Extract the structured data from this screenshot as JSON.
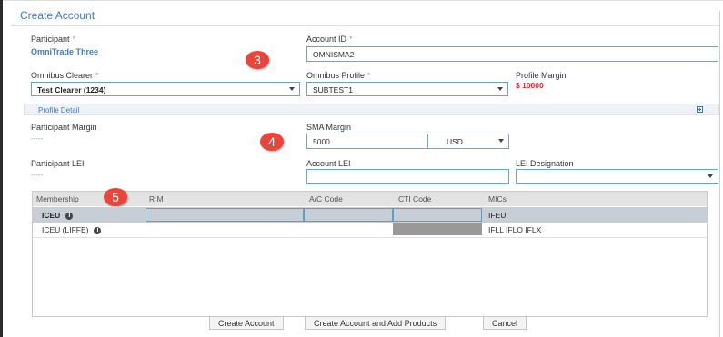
{
  "dialog": {
    "title": "Create Account"
  },
  "participant": {
    "label": "Participant",
    "req": "*",
    "value": "OmniTrade Three"
  },
  "account_id": {
    "label": "Account ID",
    "req": "*",
    "value": "OMNISMA2"
  },
  "omnibus_clearer": {
    "label": "Omnibus Clearer",
    "req": "*",
    "value": "Test Clearer (1234)"
  },
  "omnibus_profile": {
    "label": "Omnibus Profile",
    "req": "*",
    "value": "SUBTEST1"
  },
  "profile_margin": {
    "label": "Profile Margin",
    "value": "$ 10000"
  },
  "profile_detail": {
    "label": "Profile Detail"
  },
  "participant_margin": {
    "label": "Participant Margin",
    "value": "-----"
  },
  "sma_margin": {
    "label": "SMA Margin",
    "value": "5000",
    "currency": "USD"
  },
  "participant_lei": {
    "label": "Participant LEI",
    "value": "-----"
  },
  "account_lei": {
    "label": "Account LEI",
    "value": ""
  },
  "lei_designation": {
    "label": "LEI Designation",
    "value": ""
  },
  "badges": [
    "3",
    "4",
    "5"
  ],
  "table": {
    "headers": [
      "Membership",
      "RIM",
      "A/C Code",
      "CTI Code",
      "MICs"
    ],
    "rows": [
      {
        "membership": "ICEU",
        "mics": "IFEU"
      },
      {
        "membership": "ICEU (LIFFE)",
        "mics": "IFLL IFLO IFLX"
      }
    ]
  },
  "buttons": {
    "create": "Create Account",
    "create_add": "Create Account and Add Products",
    "cancel": "Cancel"
  },
  "colors": {
    "accent": "#3b7bbf",
    "badge": "#e8453c",
    "field_border": "#6aa6cc",
    "margin_red": "#e0262b"
  }
}
